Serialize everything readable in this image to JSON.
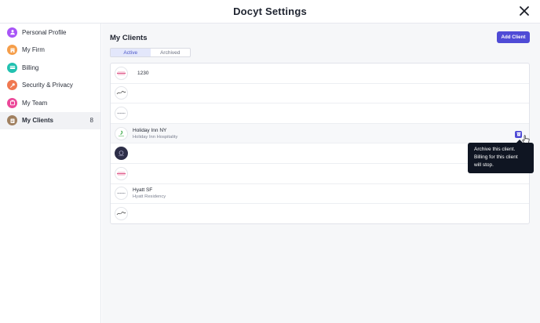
{
  "header": {
    "title": "Docyt Settings",
    "close_icon": "close-icon"
  },
  "sidebar": {
    "items": [
      {
        "label": "Personal Profile",
        "icon": "user-icon",
        "color": "#a855f7"
      },
      {
        "label": "My Firm",
        "icon": "building-icon",
        "color": "#f59e4a"
      },
      {
        "label": "Billing",
        "icon": "billing-icon",
        "color": "#22c1b0"
      },
      {
        "label": "Security & Privacy",
        "icon": "key-icon",
        "color": "#f07850"
      },
      {
        "label": "My Team",
        "icon": "team-icon",
        "color": "#ec4899"
      },
      {
        "label": "My Clients",
        "icon": "clients-icon",
        "color": "#a08060",
        "count": "8"
      }
    ]
  },
  "main": {
    "title": "My Clients",
    "add_button": "Add Client",
    "tabs": [
      {
        "label": "Active"
      },
      {
        "label": "Archived"
      }
    ],
    "clients": [
      {
        "logo": "hilton",
        "name": "1230",
        "sub": ""
      },
      {
        "logo": "script",
        "name": "",
        "sub": ""
      },
      {
        "logo": "hyatt",
        "name": "",
        "sub": ""
      },
      {
        "logo": "holiday-inn",
        "name": "Holiday Inn NY",
        "sub": "Holiday Inn Hospitality"
      },
      {
        "logo": "dark",
        "name": "",
        "sub": ""
      },
      {
        "logo": "hilton",
        "name": "",
        "sub": ""
      },
      {
        "logo": "hyatt",
        "name": "Hyatt SF",
        "sub": "Hyatt Residency"
      },
      {
        "logo": "script",
        "name": "",
        "sub": ""
      }
    ]
  },
  "tooltip": {
    "line1": "Archive this client.",
    "line2": "Billing for this client",
    "line3": "will stop."
  },
  "colors": {
    "accent": "#4f4bd6",
    "tooltip_bg": "#0f1522"
  }
}
